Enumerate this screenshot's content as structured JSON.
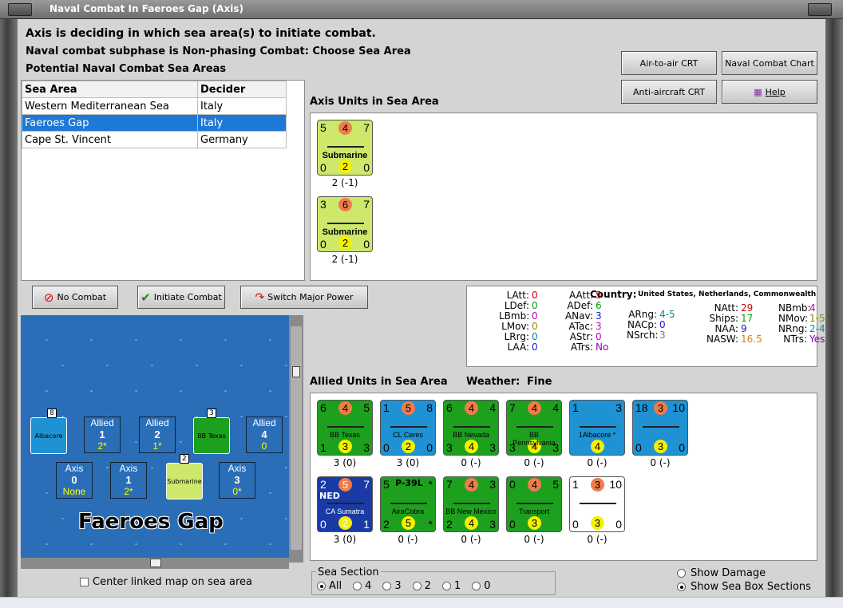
{
  "window": {
    "title": "Naval Combat In Faeroes Gap (Axis)"
  },
  "header": {
    "line1": "Axis is deciding in which sea area(s) to initiate combat.",
    "line2": "Naval combat subphase is Non-phasing Combat: Choose Sea Area",
    "line3": "Potential Naval Combat Sea Areas"
  },
  "buttons": {
    "air_to_air": "Air-to-air CRT",
    "naval_chart": "Naval Combat Chart",
    "anti_aircraft": "Anti-aircraft CRT",
    "help": "Help",
    "no_combat": "No Combat",
    "initiate": "Initiate Combat",
    "switch": "Switch Major Power"
  },
  "sea_table": {
    "headers": [
      "Sea Area",
      "Decider"
    ],
    "rows": [
      [
        "Western Mediterranean Sea",
        "Italy"
      ],
      [
        "Faeroes Gap",
        "Italy"
      ],
      [
        "Cape St. Vincent",
        "Germany"
      ]
    ],
    "selected": 1
  },
  "axis_units": {
    "title": "Axis Units in Sea Area",
    "units": [
      {
        "tl": "5",
        "tc": "4",
        "tr": "7",
        "name": "Submarine",
        "bl": "0",
        "bc": "2",
        "br": "0",
        "cap": "2 (-1)"
      },
      {
        "tl": "3",
        "tc": "6",
        "tr": "7",
        "name": "Submarine",
        "bl": "0",
        "bc": "2",
        "br": "0",
        "cap": "2 (-1)"
      }
    ]
  },
  "stats": {
    "country_label": "Country:",
    "country": "United States, Netherlands, Commonwealth",
    "col1": [
      [
        "LAtt:",
        "0",
        "red"
      ],
      [
        "LDef:",
        "0",
        "grn"
      ],
      [
        "LBmb:",
        "0",
        "mag"
      ],
      [
        "LMov:",
        "0",
        "olv"
      ],
      [
        "LRrg:",
        "0",
        "tea"
      ],
      [
        "LAA:",
        "0",
        "blu"
      ]
    ],
    "col2": [
      [
        "AAtt:",
        "5",
        "red"
      ],
      [
        "ADef:",
        "6",
        "grn"
      ],
      [
        "ANav:",
        "3",
        "blu"
      ],
      [
        "ATac:",
        "3",
        "mag"
      ],
      [
        "AStr:",
        "0",
        "mag"
      ],
      [
        "ATrs:",
        "No",
        "pur"
      ]
    ],
    "col3": [
      [
        "ARng:",
        "4-5",
        "tea"
      ],
      [
        "NACp:",
        "0",
        "blu"
      ],
      [
        "NSrch:",
        "3",
        "gry"
      ]
    ],
    "col4": [
      [
        "NAtt:",
        "29",
        "red"
      ],
      [
        "Ships:",
        "17",
        "grn"
      ],
      [
        "NAA:",
        "9",
        "blu"
      ],
      [
        "NASW:",
        "16.5",
        "org"
      ]
    ],
    "col5": [
      [
        "NBmb:",
        "4",
        "mag"
      ],
      [
        "NMov:",
        "1-5",
        "olv"
      ],
      [
        "NRng:",
        "2-4",
        "tea"
      ],
      [
        "NTrs:",
        "Yes",
        "pur"
      ]
    ]
  },
  "allied_units": {
    "title": "Allied Units in Sea Area",
    "weather_label": "Weather:",
    "weather": "Fine",
    "units": [
      {
        "color": "green",
        "tl": "6",
        "tc": "4",
        "tr": "5",
        "name": "BB Texas",
        "bl": "1",
        "bc": "3",
        "br": "3",
        "cap": "3 (0)"
      },
      {
        "color": "blue",
        "tl": "1",
        "tc": "5",
        "tr": "8",
        "name": "CL Ceres",
        "bl": "0",
        "bc": "2",
        "br": "0",
        "cap": "3 (0)"
      },
      {
        "color": "green",
        "tl": "6",
        "tc": "4",
        "tr": "4",
        "name": "BB Nevada",
        "bl": "3",
        "bc": "4",
        "br": "3",
        "cap": "0 (-)"
      },
      {
        "color": "green",
        "tl": "7",
        "tc": "4",
        "tr": "4",
        "name": "BB Pennsylvania",
        "bl": "3",
        "bc": "4",
        "br": "3",
        "cap": "0 (-)"
      },
      {
        "color": "blue",
        "tl": "1",
        "tc": "",
        "tr": "3",
        "name": "1Albacore *",
        "bl": "",
        "bc": "4",
        "br": "",
        "cap": "0 (-)"
      },
      {
        "color": "blue",
        "tl": "18",
        "tc": "3",
        "tr": "10",
        "name": "",
        "bl": "0",
        "bc": "3",
        "br": "0",
        "cap": "0 (-)"
      },
      {
        "color": "dblue",
        "tl": "2",
        "tc": "5",
        "tr": "7",
        "name": "CA Sumatra",
        "bl": "0",
        "bc": "2",
        "br": "1",
        "cap": "3 (0)"
      },
      {
        "color": "green",
        "tl": "5",
        "tc": "",
        "tr": "*",
        "name": "AiraCobra",
        "bl": "2",
        "bc": "5",
        "br": "*",
        "cap": "0 (-)"
      },
      {
        "color": "green",
        "tl": "7",
        "tc": "4",
        "tr": "3",
        "name": "BB New Mexico",
        "bl": "2",
        "bc": "4",
        "br": "3",
        "cap": "0 (-)"
      },
      {
        "color": "green",
        "tl": "0",
        "tc": "4",
        "tr": "5",
        "name": "Transport",
        "bl": "0",
        "bc": "3",
        "br": "",
        "cap": "0 (-)"
      },
      {
        "color": "white",
        "tl": "1",
        "tc": "3",
        "tr": "10",
        "name": "",
        "bl": "0",
        "bc": "3",
        "br": "0",
        "cap": "0 (-)"
      }
    ],
    "ned": "NED",
    "p39": "P-39L"
  },
  "map": {
    "name": "Faeroes Gap",
    "allied_boxes": [
      [
        "Allied",
        "1",
        "2*"
      ],
      [
        "Allied",
        "2",
        "1*"
      ],
      [
        "Allied",
        "4",
        "0"
      ]
    ],
    "axis_boxes": [
      [
        "Axis",
        "0",
        "None"
      ],
      [
        "Axis",
        "1",
        "2*"
      ],
      [
        "Axis",
        "3",
        "0*"
      ]
    ],
    "stack_counts": [
      "8",
      "3",
      "2"
    ],
    "albacore": "Albacore",
    "bbtexas": "BB Texas",
    "sub": "Submarine"
  },
  "footer": {
    "center_linked": "Center linked map on sea area",
    "sea_section": "Sea Section",
    "options": [
      "All",
      "4",
      "3",
      "2",
      "1",
      "0"
    ],
    "show_damage": "Show Damage",
    "show_boxes": "Show Sea Box Sections"
  }
}
